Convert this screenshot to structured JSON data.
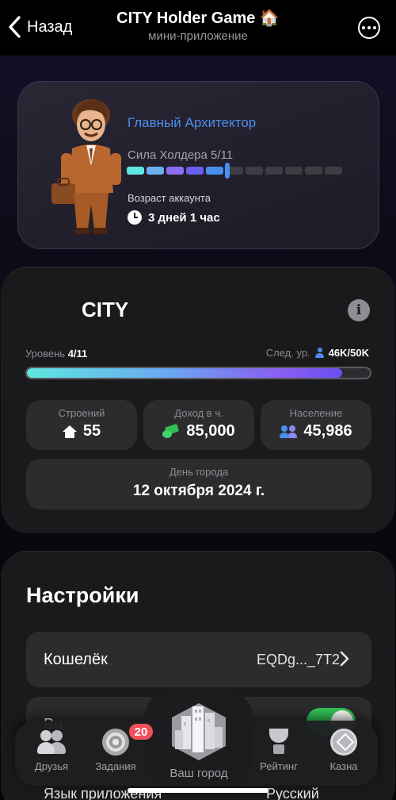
{
  "header": {
    "back_label": "Назад",
    "title": "CITY Holder Game 🏠",
    "subtitle": "мини-приложение"
  },
  "profile": {
    "name": "Главный Архитектор",
    "power_label": "Сила Холдера 5/11",
    "power_current": 5,
    "power_max": 11,
    "age_label": "Возраст аккаунта",
    "age_value": "3 дней 1 час",
    "accent_color": "#4a8ff0"
  },
  "city": {
    "title": "CITY",
    "level_label": "Уровень",
    "level_value": "4/11",
    "next_label": "След. ур.",
    "next_value": "46K/50K",
    "progress_fraction": 0.92,
    "stats": [
      {
        "label": "Строений",
        "value": "55",
        "icon": "house-icon"
      },
      {
        "label": "Доход в ч.",
        "value": "85,000",
        "icon": "money-icon"
      },
      {
        "label": "Население",
        "value": "45,986",
        "icon": "people-icon"
      }
    ],
    "day_label": "День города",
    "day_value": "12 октября 2024 г."
  },
  "settings": {
    "title": "Настройки",
    "wallet_label": "Кошелёк",
    "wallet_value": "EQDg..._7T2",
    "row2_label_partial": "Ви",
    "language_label": "Язык приложения",
    "language_value": "Русский",
    "toggle_color": "#34c759"
  },
  "nav": {
    "items": [
      {
        "label": "Друзья",
        "icon": "friends-icon"
      },
      {
        "label": "Задания",
        "icon": "tasks-icon",
        "badge": "20"
      },
      {
        "label": "Ваш город",
        "icon": "city-icon"
      },
      {
        "label": "Рейтинг",
        "icon": "trophy-icon"
      },
      {
        "label": "Казна",
        "icon": "treasury-icon"
      }
    ]
  }
}
